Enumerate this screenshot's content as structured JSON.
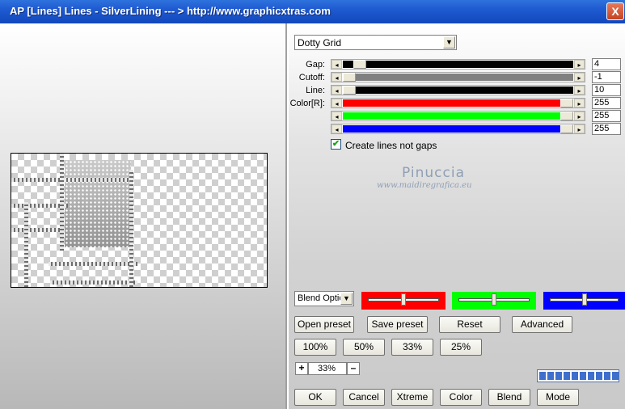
{
  "window": {
    "title": "AP [Lines]  Lines - SilverLining     --- > http://www.graphicxtras.com",
    "close_glyph": "X"
  },
  "pattern": {
    "selected": "Dotty Grid"
  },
  "sliders": [
    {
      "label": "Gap:",
      "value": "4",
      "fill": "#000000",
      "fill_fraction": 1.0,
      "thumb_fraction": 0.05
    },
    {
      "label": "Cutoff:",
      "value": "-1",
      "fill": "#808080",
      "fill_fraction": 1.0,
      "thumb_fraction": 0.0
    },
    {
      "label": "Line:",
      "value": "10",
      "fill": "#000000",
      "fill_fraction": 1.0,
      "thumb_fraction": 0.0
    },
    {
      "label": "Color[R]:",
      "value": "255",
      "fill": "#ff0000",
      "fill_fraction": 1.0,
      "thumb_fraction": 1.0
    },
    {
      "label": "",
      "value": "255",
      "fill": "#00ff00",
      "fill_fraction": 1.0,
      "thumb_fraction": 1.0
    },
    {
      "label": "",
      "value": "255",
      "fill": "#0000ff",
      "fill_fraction": 1.0,
      "thumb_fraction": 1.0
    }
  ],
  "options": {
    "create_lines_label": "Create lines not gaps",
    "create_lines_checked": true
  },
  "watermark": {
    "name": "Pinuccia",
    "site": "www.maidiregrafica.eu"
  },
  "blend": {
    "selected": "Blend Optio"
  },
  "color_bars": [
    {
      "name": "red",
      "color": "#ff0000",
      "level": 0.5
    },
    {
      "name": "green",
      "color": "#00ff00",
      "level": 0.5
    },
    {
      "name": "blue",
      "color": "#0000ff",
      "level": 0.5
    }
  ],
  "buttons": {
    "open_preset": "Open preset",
    "save_preset": "Save preset",
    "reset": "Reset",
    "advanced": "Advanced",
    "z100": "100%",
    "z50": "50%",
    "z33": "33%",
    "z25": "25%",
    "ok": "OK",
    "cancel": "Cancel",
    "xtreme": "Xtreme",
    "color": "Color",
    "blend": "Blend",
    "mode": "Mode"
  },
  "zoom": {
    "plus": "+",
    "minus": "–",
    "value": "33%"
  },
  "progress": {
    "total_blocks": 10,
    "filled_blocks": 10,
    "color": "#3e6fcc"
  }
}
